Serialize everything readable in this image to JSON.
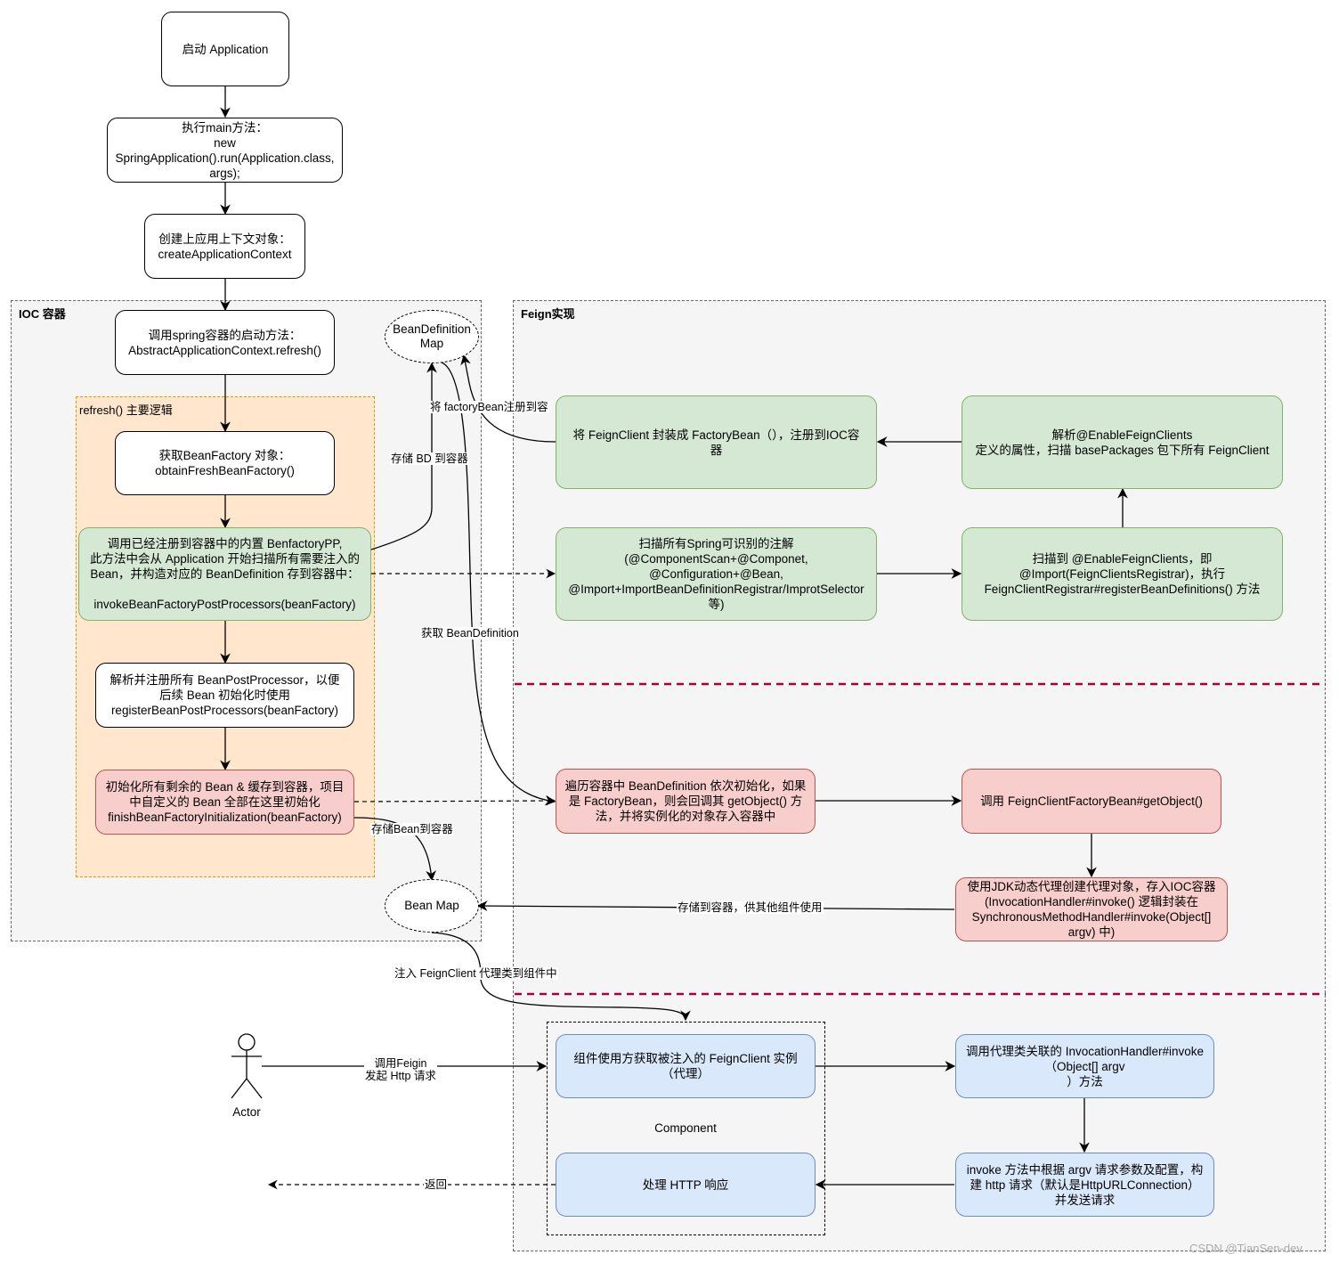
{
  "top_flow": {
    "start": "启动 Application",
    "main": "执行main方法：\nnew\nSpringApplication().run(Application.class,\nargs);",
    "create_context": "创建上应用上下文对象：\ncreateApplicationContext"
  },
  "ioc_container": {
    "title": "IOC 容器",
    "refresh_call": "调用spring容器的启动方法：\nAbstractApplicationContext.refresh()",
    "refresh_group": {
      "title": "refresh() 主要逻辑",
      "obtain_factory": "获取BeanFactory 对象：\nobtainFreshBeanFactory()",
      "invoke_pp": "调用已经注册到容器中的内置 BenfactoryPP,\n此方法中会从 Application 开始扫描所有需要注入的\nBean，并构造对应的 BeanDefinition 存到容器中：\n\ninvokeBeanFactoryPostProcessors(beanFactory)",
      "register_bpp": "解析并注册所有 BeanPostProcessor，以便\n后续 Bean 初始化时使用\nregisterBeanPostProcessors(beanFactory)",
      "finish_init": "初始化所有剩余的 Bean & 缓存到容器，项目\n中自定义的 Bean 全部在这里初始化\nfinishBeanFactoryInitialization(beanFactory)"
    },
    "bean_definition_map": "BeanDefinition\nMap",
    "bean_map": "Bean Map"
  },
  "feign": {
    "title": "Feign实现",
    "wrap_factory_bean": "将 FeignClient 封装成 FactoryBean（），注册到IOC容\n器",
    "parse_enable": "解析@EnableFeignClients\n定义的属性，扫描 basePackages 包下所有 FeignClient",
    "scan_annotations": "扫描所有Spring可识别的注解\n(@ComponentScan+@Componet,\n@Configuration+@Bean,\n@Import+ImportBeanDefinitionRegistrar/ImprotSelector\n等)",
    "scan_enable": "扫描到 @EnableFeignClients，即\n@Import(FeignClientsRegistrar)，执行\nFeignClientRegistrar#registerBeanDefinitions() 方法",
    "iterate_bd": "遍历容器中 BeanDefinition 依次初始化，如果\n是 FactoryBean，则会回调其 getObject() 方\n法，并将实例化的对象存入容器中",
    "get_object": "调用 FeignClientFactoryBean#getObject()",
    "jdk_proxy": "使用JDK动态代理创建代理对象，存入IOC容器\n(InvocationHandler#invoke() 逻辑封装在\nSynchronousMethodHandler#invoke(Object[]\nargv) 中)",
    "invoke_handler": "调用代理类关联的 InvocationHandler#invoke\n（Object[] argv\n）方法",
    "build_http": "invoke 方法中根据 argv 请求参数及配置，构\n建 http 请求（默认是HttpURLConnection）\n并发送请求"
  },
  "component": {
    "label": "Component",
    "get_instance": "组件使用方获取被注入的 FeignClient 实例\n（代理）",
    "handle_response": "处理 HTTP 响应"
  },
  "actor": {
    "label": "Actor"
  },
  "edge_labels": {
    "store_bd": "存储 BD 到容器",
    "register_factory_bean": "将 factoryBean注册到容",
    "get_bd": "获取 BeanDefinition",
    "store_bean": "存储Bean到容器",
    "store_for_use": "存储到容器，供其他组件使用",
    "inject_proxy": "注入 FeignClient 代理类到组件中",
    "call_feign": "调用Feigin\n发起 Http 请求",
    "return": "返回"
  },
  "colors": {
    "container_bg": "#f5f5f5",
    "orange_fill": "#ffe6cc",
    "orange_border": "#d79b00",
    "green_fill": "#d5e8d4",
    "green_border": "#82b366",
    "red_fill": "#f8cecc",
    "red_border": "#b85450",
    "blue_fill": "#dae8fc",
    "blue_border": "#6c8ebf",
    "separator": "#a50040"
  },
  "watermark": "CSDN @TianSen-dev"
}
